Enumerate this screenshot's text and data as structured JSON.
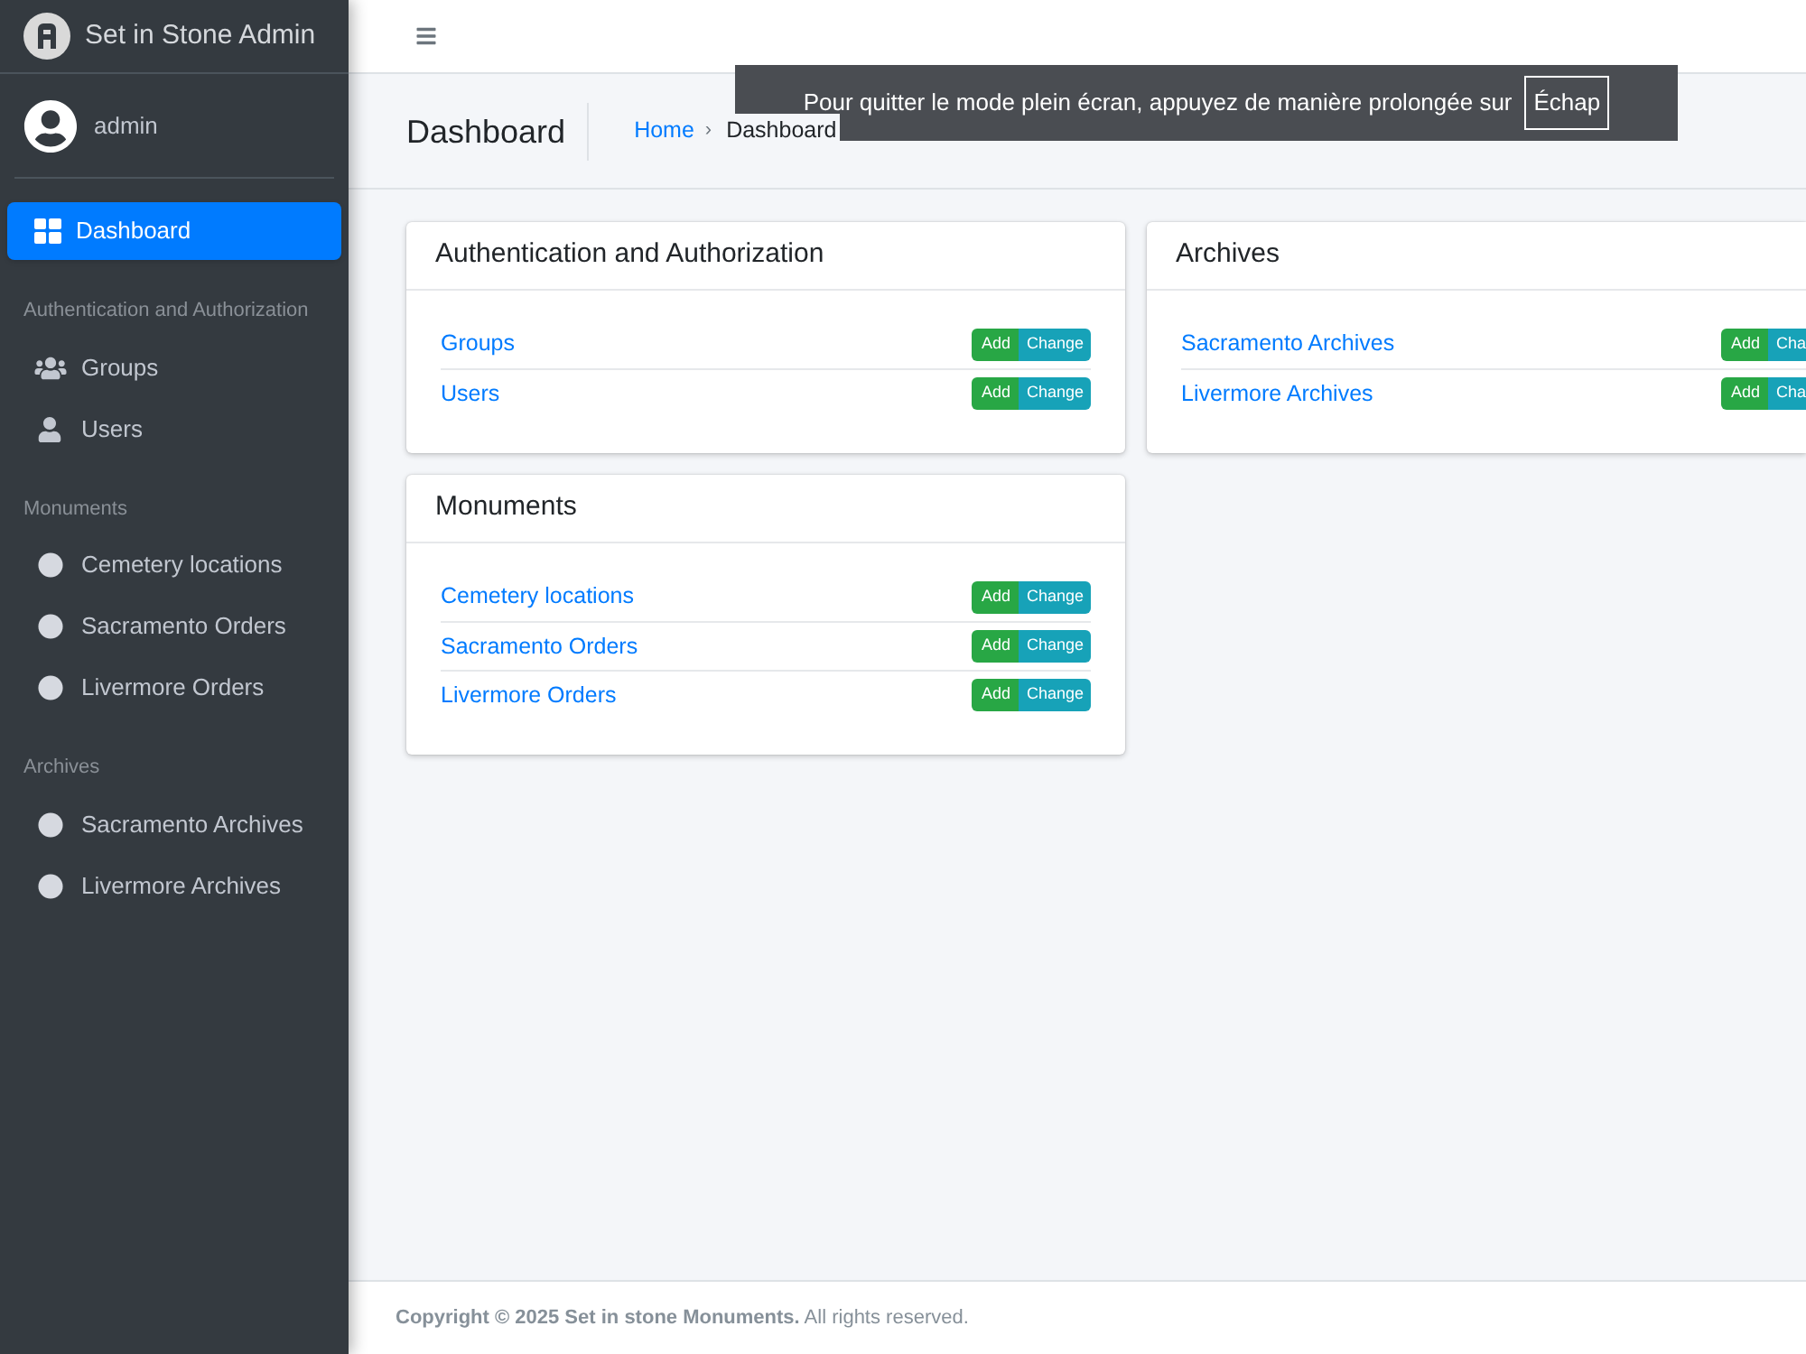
{
  "brand": {
    "title": "Set in Stone Admin"
  },
  "user": {
    "name": "admin"
  },
  "sidebar": {
    "items": [
      {
        "kind": "dashboard",
        "label": "Dashboard",
        "selected": true
      },
      {
        "kind": "header",
        "label": "Authentication and Authorization"
      },
      {
        "kind": "groups",
        "label": "Groups",
        "selected": false
      },
      {
        "kind": "users",
        "label": "Users",
        "selected": false
      },
      {
        "kind": "header",
        "label": "Monuments"
      },
      {
        "kind": "model",
        "label": "Cemetery locations",
        "selected": false
      },
      {
        "kind": "model",
        "label": "Sacramento Orders",
        "selected": false
      },
      {
        "kind": "model",
        "label": "Livermore Orders",
        "selected": false
      },
      {
        "kind": "header",
        "label": "Archives"
      },
      {
        "kind": "model",
        "label": "Sacramento Archives",
        "selected": false
      },
      {
        "kind": "model",
        "label": "Livermore Archives",
        "selected": false
      }
    ]
  },
  "page_title": "Dashboard",
  "breadcrumb": {
    "items": [
      "Home",
      "Dashboard"
    ],
    "separator": "›"
  },
  "fullscreen_notice": {
    "text": "Pour quitter le mode plein écran, appuyez de manière prolongée sur",
    "key": "Échap"
  },
  "columns": [
    [
      {
        "title": "Authentication and Authorization",
        "rows": [
          {
            "label": "Groups",
            "add": "Add",
            "change": "Change"
          },
          {
            "label": "Users",
            "add": "Add",
            "change": "Change"
          }
        ]
      },
      {
        "title": "Monuments",
        "rows": [
          {
            "label": "Cemetery locations",
            "add": "Add",
            "change": "Change"
          },
          {
            "label": "Sacramento Orders",
            "add": "Add",
            "change": "Change"
          },
          {
            "label": "Livermore Orders",
            "add": "Add",
            "change": "Change"
          }
        ]
      }
    ],
    [
      {
        "title": "Archives",
        "rows": [
          {
            "label": "Sacramento Archives",
            "add": "Add",
            "change": "Cha"
          },
          {
            "label": "Livermore Archives",
            "add": "Add",
            "change": "Cha"
          }
        ]
      }
    ]
  ],
  "footer": {
    "text": "**Copyright © 2025 Set in stone Monuments.** All rights reserved."
  }
}
